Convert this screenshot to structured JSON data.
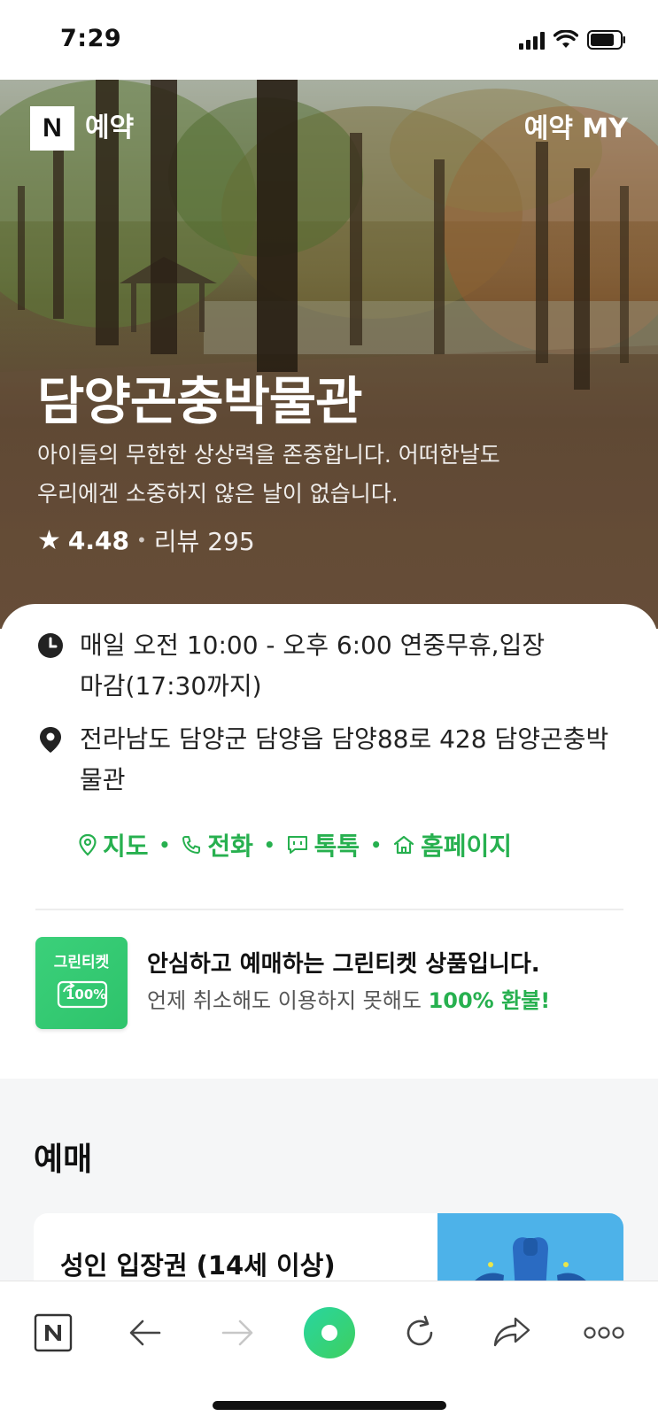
{
  "status_bar": {
    "time": "7:29"
  },
  "header": {
    "brand_logo": "N",
    "brand_label": "예약",
    "my_link": "예약 MY"
  },
  "place": {
    "name": "담양곤충박물관",
    "description_line1": "아이들의 무한한 상상력을 존중합니다. 어떠한날도",
    "description_line2": "우리에겐 소중하지 않은 날이 없습니다.",
    "rating": "4.48",
    "review_label": "리뷰 295"
  },
  "info": {
    "hours_line1": "매일 오전 10:00 - 오후 6:00 연중무휴,입장",
    "hours_line2": "마감(17:30까지)",
    "address_line1": "전라남도 담양군 담양읍 담양88로 428 담양곤충박",
    "address_line2": "물관",
    "links": [
      "지도",
      "전화",
      "톡톡",
      "홈페이지"
    ],
    "icons": {
      "hours": "clock-icon",
      "address": "location-pin-icon"
    }
  },
  "green_ticket": {
    "badge_title": "그린티켓",
    "badge_percent": "100%",
    "headline": "안심하고 예매하는 그린티켓 상품입니다.",
    "subline": "언제 취소해도 이용하지 못해도",
    "highlight": "100% 환불!"
  },
  "booking": {
    "section_title": "예매",
    "products": [
      {
        "name": "성인 입장권 (14세 이상)"
      }
    ]
  },
  "toolbar": {
    "items": [
      "naver-home-icon",
      "back-arrow-icon",
      "forward-arrow-icon",
      "green-dot-icon",
      "refresh-icon",
      "share-icon",
      "more-icon"
    ]
  },
  "colors": {
    "accent_green": "#27b04f",
    "hero_brown": "#634a34",
    "thumb_blue": "#4db2e9"
  }
}
